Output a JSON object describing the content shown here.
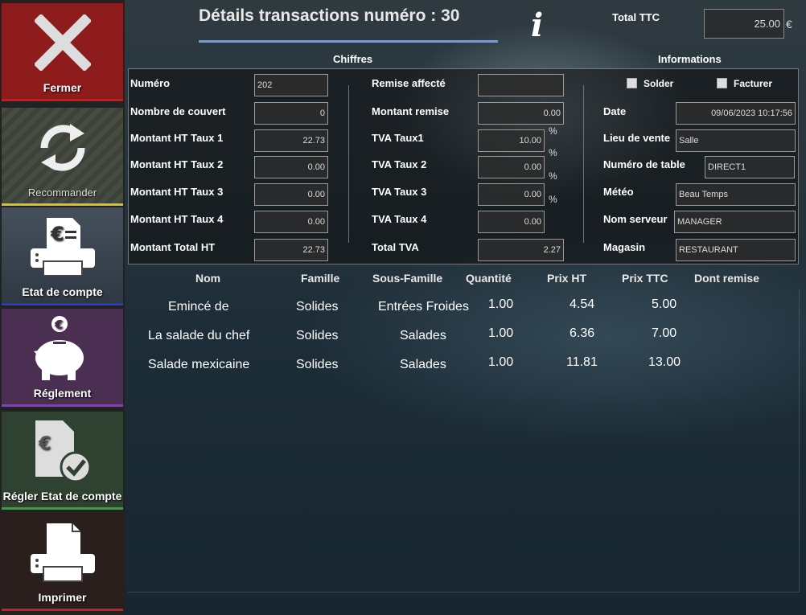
{
  "title": "Détails transactions numéro : 30",
  "total_ttc": {
    "label": "Total TTC",
    "value": "25.00",
    "currency": "€"
  },
  "sections": {
    "chiffres": "Chiffres",
    "informations": "Informations"
  },
  "sidebar": {
    "fermer": "Fermer",
    "recommander": "Recommander",
    "etat_compte": "Etat de compte",
    "reglement": "Réglement",
    "regler_etat": "Régler Etat de compte",
    "imprimer": "Imprimer"
  },
  "chiffres": {
    "numero": {
      "label": "Numéro",
      "value": "202"
    },
    "couvert": {
      "label": "Nombre de couvert",
      "value": "0"
    },
    "ht1": {
      "label": "Montant HT Taux 1",
      "value": "22.73"
    },
    "ht2": {
      "label": "Montant HT Taux 2",
      "value": "0.00"
    },
    "ht3": {
      "label": "Montant HT Taux 3",
      "value": "0.00"
    },
    "ht4": {
      "label": "Montant HT Taux 4",
      "value": "0.00"
    },
    "total_ht": {
      "label": "Montant Total HT",
      "value": "22.73"
    }
  },
  "tva": {
    "remise_affecte": {
      "label": "Remise affecté",
      "value": ""
    },
    "montant_remise": {
      "label": "Montant remise",
      "value": "0.00"
    },
    "taux1": {
      "label": "TVA Taux1",
      "value": "10.00"
    },
    "taux2": {
      "label": "TVA Taux 2",
      "value": "0.00"
    },
    "taux3": {
      "label": "TVA Taux 3",
      "value": "0.00"
    },
    "taux4": {
      "label": "TVA Taux 4",
      "value": "0.00"
    },
    "total": {
      "label": "Total TVA",
      "value": "2.27"
    },
    "pct": "%"
  },
  "info": {
    "solder": "Solder",
    "facturer": "Facturer",
    "date": {
      "label": "Date",
      "value": "09/06/2023 10:17:56"
    },
    "lieu": {
      "label": "Lieu de vente",
      "value": "Salle"
    },
    "table": {
      "label": "Numéro de table",
      "value": "DIRECT1"
    },
    "meteo": {
      "label": "Météo",
      "value": "Beau Temps"
    },
    "serveur": {
      "label": "Nom serveur",
      "value": "MANAGER"
    },
    "magasin": {
      "label": "Magasin",
      "value": "RESTAURANT"
    }
  },
  "table": {
    "headers": [
      "Nom",
      "Famille",
      "Sous-Famille",
      "Quantité",
      "Prix HT",
      "Prix TTC",
      "Dont remise"
    ],
    "rows": [
      [
        "Emincé de",
        "Solides",
        "Entrées Froides",
        "1.00",
        "4.54",
        "5.00",
        ""
      ],
      [
        "La salade du chef",
        "Solides",
        "Salades",
        "1.00",
        "6.36",
        "7.00",
        ""
      ],
      [
        "Salade mexicaine",
        "Solides",
        "Salades",
        "1.00",
        "11.81",
        "13.00",
        ""
      ]
    ]
  },
  "colors": {
    "fermer": "#8e1c1c",
    "accent_line": "#7d9ac8",
    "separator": "#2d8f8f"
  }
}
